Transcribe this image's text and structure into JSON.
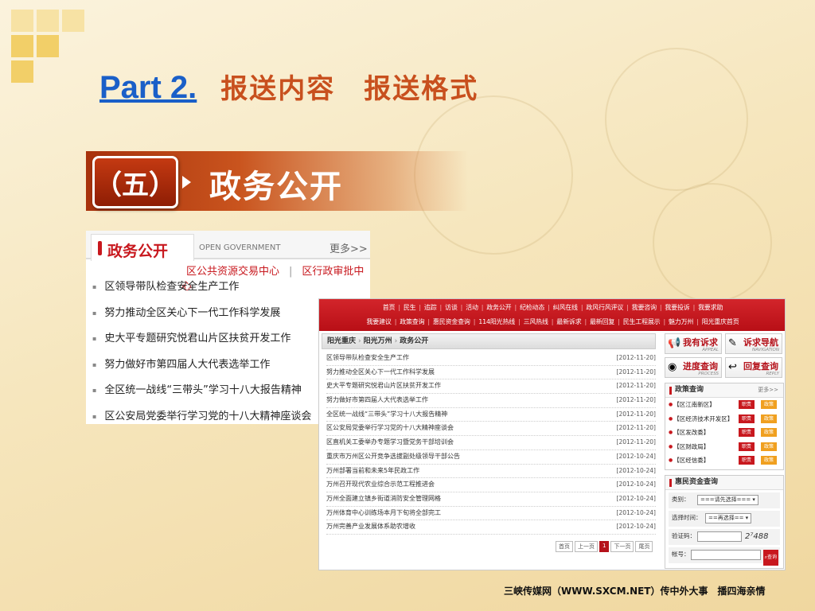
{
  "header": {
    "part": "Part 2.",
    "title": "报送内容　报送格式"
  },
  "banner": {
    "badge": "（五）",
    "title": "政务公开"
  },
  "left_panel": {
    "tab": "政务公开",
    "subtitle": "OPEN GOVERNMENT",
    "more": "更多>>",
    "links": [
      "区公共资源交易中心",
      "区行政审批中心"
    ],
    "items": [
      "区领导带队检查安全生产工作",
      "努力推动全区关心下一代工作科学发展",
      "史大平专题研究悦君山片区扶贫开发工作",
      "努力做好市第四届人大代表选举工作",
      "全区统一战线“三带头”学习十八大报告精神",
      "区公安局党委举行学习党的十八大精神座谈会"
    ]
  },
  "right_panel": {
    "nav_row1": [
      "首页",
      "民生",
      "追踪",
      "访谈",
      "活动",
      "政务公开",
      "纪检动态",
      "纠风在线",
      "政风行风评议",
      "我要咨询",
      "我要投诉",
      "我要求助"
    ],
    "nav_row2": [
      "我要建议",
      "政策查询",
      "惠民资金查询",
      "114阳光热线",
      "三风热线",
      "最新诉求",
      "最新回复",
      "民生工程展示",
      "魅力万州",
      "阳光重庆首页"
    ],
    "breadcrumb": [
      "阳光重庆",
      "阳光万州",
      "政务公开"
    ],
    "items": [
      {
        "title": "区领导带队检查安全生产工作",
        "date": "[2012-11-20]"
      },
      {
        "title": "努力推动全区关心下一代工作科学发展",
        "date": "[2012-11-20]"
      },
      {
        "title": "史大平专题研究悦君山片区扶贫开发工作",
        "date": "[2012-11-20]"
      },
      {
        "title": "努力做好市第四届人大代表选举工作",
        "date": "[2012-11-20]"
      },
      {
        "title": "全区统一战线“三带头”学习十八大报告精神",
        "date": "[2012-11-20]"
      },
      {
        "title": "区公安局党委举行学习党的十八大精神座谈会",
        "date": "[2012-11-20]"
      },
      {
        "title": "区直机关工委举办专题学习暨党务干部培训会",
        "date": "[2012-11-20]"
      },
      {
        "title": "重庆市万州区公开竞争选拔副处级领导干部公告",
        "date": "[2012-10-24]"
      },
      {
        "title": "万州部署当前和未来5年民政工作",
        "date": "[2012-10-24]"
      },
      {
        "title": "万州召开现代农业综合示范工程推进会",
        "date": "[2012-10-24]"
      },
      {
        "title": "万州全面建立镇乡街道消防安全管理网格",
        "date": "[2012-10-24]"
      },
      {
        "title": "万州体育中心训练场本月下旬将全部完工",
        "date": "[2012-10-24]"
      },
      {
        "title": "万州完善产业发展体系助农增收",
        "date": "[2012-10-24]"
      }
    ],
    "pager": [
      "首页",
      "上一页",
      "1",
      "下一页",
      "尾页"
    ],
    "side_buttons": [
      {
        "label": "我有诉求",
        "en": "APPEAL"
      },
      {
        "label": "诉求导航",
        "en": "NAVIGATION"
      },
      {
        "label": "进度查询",
        "en": "PROCESS"
      },
      {
        "label": "回复查询",
        "en": "REPLY"
      }
    ],
    "policy": {
      "title": "政策查询",
      "more": "更多>>",
      "badge1": "职责",
      "badge2": "政策",
      "rows": [
        "【区江南新区】",
        "【区经济技术开发区】",
        "【区发改委】",
        "【区财政局】",
        "【区经信委】"
      ]
    },
    "funds": {
      "title": "惠民资金查询",
      "category_label": "类别：",
      "category_value": "===请先选择=== ▾",
      "time_label": "选择时间：",
      "time_value": "==再选择== ▾",
      "code_label": "验证码：",
      "captcha": "2⁷488",
      "account_label": "帐号：",
      "search": "查询"
    }
  },
  "footer": "三峡传媒网（WWW.SXCM.NET）传中外大事　播四海亲情"
}
